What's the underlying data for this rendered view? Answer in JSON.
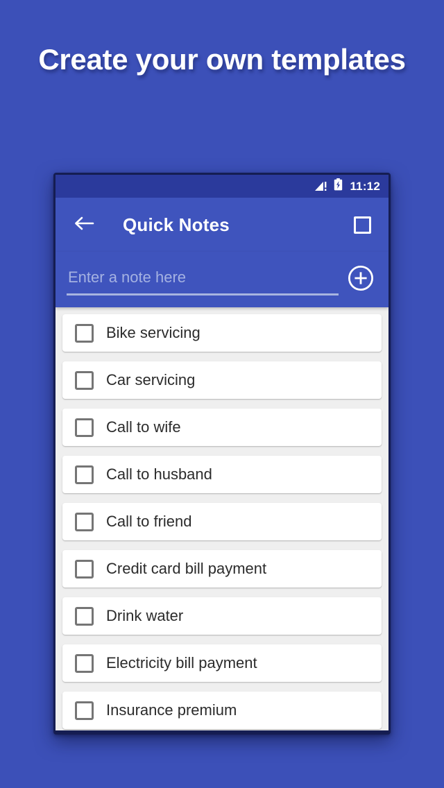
{
  "promo": {
    "headline": "Create your own templates",
    "background_color": "#3c50b8"
  },
  "phone": {
    "statusbar": {
      "time": "11:12",
      "signal_icon": "signal-warning-icon",
      "battery_icon": "battery-charging-icon",
      "background_color": "#2b3a9c"
    },
    "appbar": {
      "back_icon": "back-arrow-icon",
      "title": "Quick Notes",
      "action_icon": "select-all-square-icon",
      "background_color": "#3f54bd"
    },
    "input": {
      "placeholder": "Enter a note here",
      "value": "",
      "add_icon": "add-circle-icon"
    },
    "notes": [
      {
        "label": "Bike servicing",
        "checked": false
      },
      {
        "label": "Car servicing",
        "checked": false
      },
      {
        "label": "Call to wife",
        "checked": false
      },
      {
        "label": "Call to husband",
        "checked": false
      },
      {
        "label": "Call to friend",
        "checked": false
      },
      {
        "label": "Credit card bill payment",
        "checked": false
      },
      {
        "label": "Drink water",
        "checked": false
      },
      {
        "label": "Electricity bill payment",
        "checked": false
      },
      {
        "label": "Insurance premium",
        "checked": false
      }
    ]
  }
}
